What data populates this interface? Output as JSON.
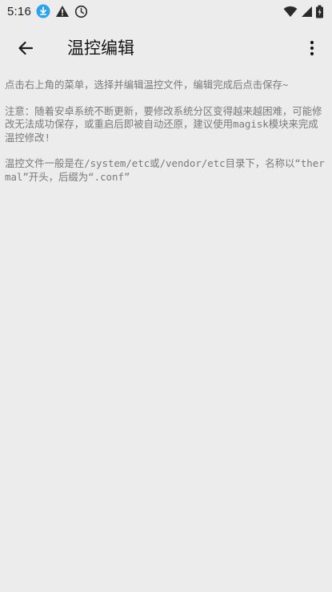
{
  "status_bar": {
    "time": "5:16",
    "icons": [
      "download-icon",
      "warning-icon",
      "clock-icon",
      "wifi-icon",
      "signal-icon",
      "battery-icon"
    ]
  },
  "app_bar": {
    "title": "温控编辑",
    "back_icon": "arrow-back-icon",
    "more_icon": "more-vert-icon"
  },
  "content": {
    "paragraphs": [
      "点击右上角的菜单，选择并编辑温控文件，编辑完成后点击保存~",
      "注意：随着安卓系统不断更新，要修改系统分区变得越来越困难，可能修改无法成功保存，或重启后即被自动还原，建议使用magisk模块来完成温控修改!",
      "温控文件一般是在/system/etc或/vendor/etc目录下，名称以“thermal”开头，后缀为“.conf”"
    ]
  },
  "colors": {
    "background": "#ececec",
    "text_primary": "#141414",
    "text_secondary": "#7a7a7a",
    "accent": "#29a3f0"
  }
}
